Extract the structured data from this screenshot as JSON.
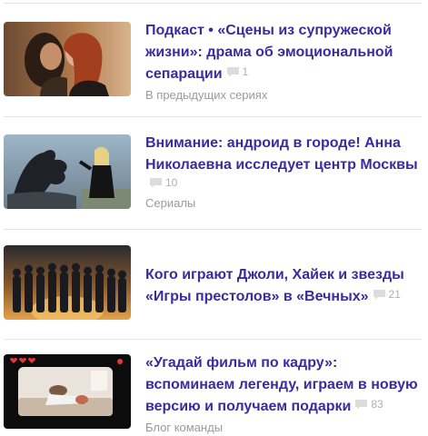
{
  "items": [
    {
      "title": "Подкаст • «Сцены из супружеской жизни»: драма об эмоциональной сепарации",
      "comments": "1",
      "category": "В предыдущих сериях",
      "thumb_icon": "couple-photo"
    },
    {
      "title": "Внимание: андроид в городе! Анна Николаевна исследует центр Москвы",
      "comments": "10",
      "category": "Сериалы",
      "thumb_icon": "statue-photo"
    },
    {
      "title": "Кого играют Джоли, Хайек и звезды «Игры престолов» в «Вечных»",
      "comments": "21",
      "category": "",
      "thumb_icon": "group-photo"
    },
    {
      "title": "«Угадай фильм по кадру»: вспоминаем легенду, играем в новую версию и получаем подарки",
      "comments": "83",
      "category": "Блог команды",
      "thumb_icon": "game-screen-photo"
    }
  ],
  "colors": {
    "title": "#3a2ba0",
    "meta": "#9a9a9a",
    "separator": "#e6e6e6"
  }
}
